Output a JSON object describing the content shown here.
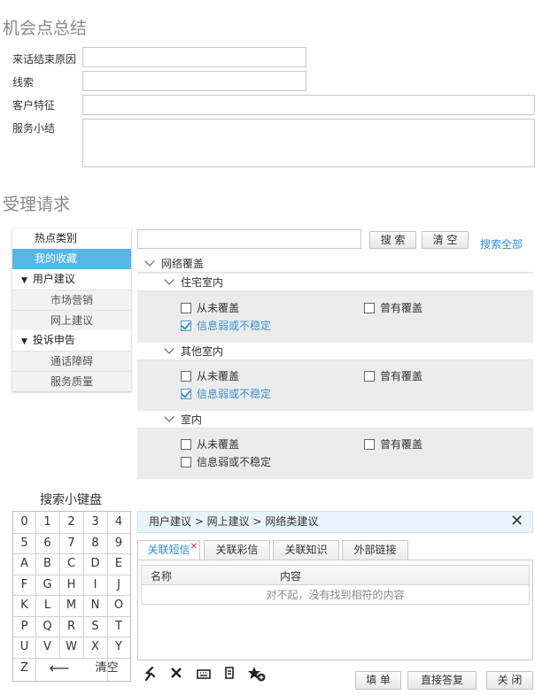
{
  "section1": {
    "title": "机会点总结",
    "fields": [
      {
        "label": "来话结束原因",
        "value": ""
      },
      {
        "label": "线索",
        "value": ""
      },
      {
        "label": "客户特征",
        "value": ""
      },
      {
        "label": "服务小结",
        "value": ""
      }
    ]
  },
  "section2": {
    "title": "受理请求"
  },
  "nav": {
    "hot": "热点类别",
    "favorites": "我的收藏",
    "group1": "用户建议",
    "group1_items": [
      "市场营销",
      "网上建议"
    ],
    "group2": "投诉申告",
    "group2_items": [
      "通话障碍",
      "服务质量"
    ]
  },
  "search": {
    "value": "",
    "search_button": "搜 索",
    "clear_button": "清 空",
    "search_all": "搜索全部"
  },
  "tree": {
    "root": "网络覆盖",
    "groups": [
      {
        "name": "住宅室内",
        "options": [
          {
            "label": "从未覆盖",
            "checked": false
          },
          {
            "label": "曾有覆盖",
            "checked": false
          },
          {
            "label": "信息弱或不稳定",
            "checked": true
          }
        ]
      },
      {
        "name": "其他室内",
        "options": [
          {
            "label": "从未覆盖",
            "checked": false
          },
          {
            "label": "曾有覆盖",
            "checked": false
          },
          {
            "label": "信息弱或不稳定",
            "checked": true
          }
        ]
      },
      {
        "name": "室内",
        "options": [
          {
            "label": "从未覆盖",
            "checked": false
          },
          {
            "label": "曾有覆盖",
            "checked": false
          },
          {
            "label": "信息弱或不稳定",
            "checked": false
          }
        ]
      }
    ]
  },
  "keypad": {
    "title": "搜索小键盘",
    "rows": [
      [
        "0",
        "1",
        "2",
        "3",
        "4"
      ],
      [
        "5",
        "6",
        "7",
        "8",
        "9"
      ],
      [
        "A",
        "B",
        "C",
        "D",
        "E"
      ],
      [
        "F",
        "G",
        "H",
        "I",
        "J"
      ],
      [
        "K",
        "L",
        "M",
        "N",
        "O"
      ],
      [
        "P",
        "Q",
        "R",
        "S",
        "T"
      ],
      [
        "U",
        "V",
        "W",
        "X",
        "Y"
      ]
    ],
    "last_row": {
      "z": "Z",
      "backspace": "⟵",
      "clear": "清空"
    }
  },
  "detail": {
    "breadcrumb": "用户建议 > 网上建议 > 网络类建议",
    "close_icon": "✕",
    "tabs": [
      "关联短信",
      "关联彩信",
      "关联知识",
      "外部链接"
    ],
    "active_tab": 0,
    "table": {
      "headers": [
        "名称",
        "内容"
      ],
      "empty_text": "对不起，没有找到相符的内容"
    }
  },
  "toolbar": {
    "icons": [
      "link-icon",
      "close-icon",
      "keyboard-icon",
      "note-icon",
      "star-add-icon"
    ],
    "glyphs": [
      "ⵢ",
      "✕",
      "⌨",
      "▤",
      "★"
    ],
    "fill_button": "填 单",
    "reply_button": "直接答复",
    "close_button": "关 闭"
  },
  "colors": {
    "accent": "#56b6e8",
    "link": "#2f8dd6",
    "checked": "#3a8fd0"
  }
}
